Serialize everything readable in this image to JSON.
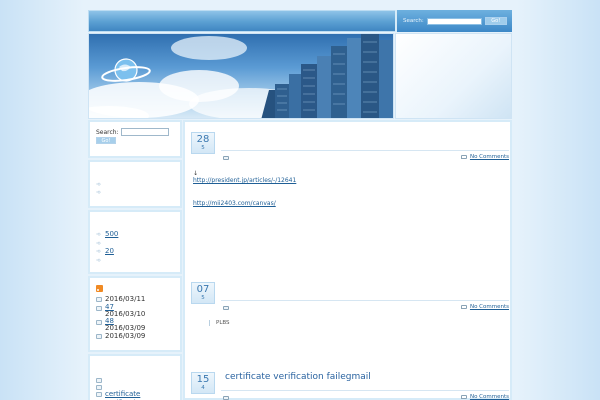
{
  "header": {
    "search_label": "Search:",
    "search_button": "Go!"
  },
  "sidebar": {
    "search": {
      "label": "Search:",
      "button": "Go!"
    },
    "box2": {
      "items": [
        "",
        ""
      ]
    },
    "box3": {
      "items": [
        "500 ",
        "",
        "20 ",
        ""
      ]
    },
    "box4": {
      "items": [
        {
          "link": "",
          "date": "2016/03/11"
        },
        {
          "link": "47",
          "date": "2016/03/10"
        },
        {
          "link": "48",
          "date": "2016/03/09"
        },
        {
          "link": "",
          "date": "2016/03/09"
        }
      ]
    },
    "box5": {
      "items": [
        "",
        "",
        "certificate verification"
      ]
    }
  },
  "posts": [
    {
      "day": "28",
      "month": "5",
      "title": "",
      "comments": "No Comments",
      "body": {
        "arrow": "↓",
        "link1": "http://president.jp/articles/-/12641",
        "link2": "http://mii2403.com/canvas/"
      }
    },
    {
      "day": "07",
      "month": "5",
      "title": "",
      "comments": "No Comments",
      "body": {
        "text": "PLBS"
      }
    },
    {
      "day": "15",
      "month": "4",
      "title": "certificate verification failegmail",
      "comments": "No Comments"
    }
  ],
  "colors": {
    "accent": "#3f86c2",
    "link": "#1f5f96",
    "frame": "#d6ebf8"
  }
}
